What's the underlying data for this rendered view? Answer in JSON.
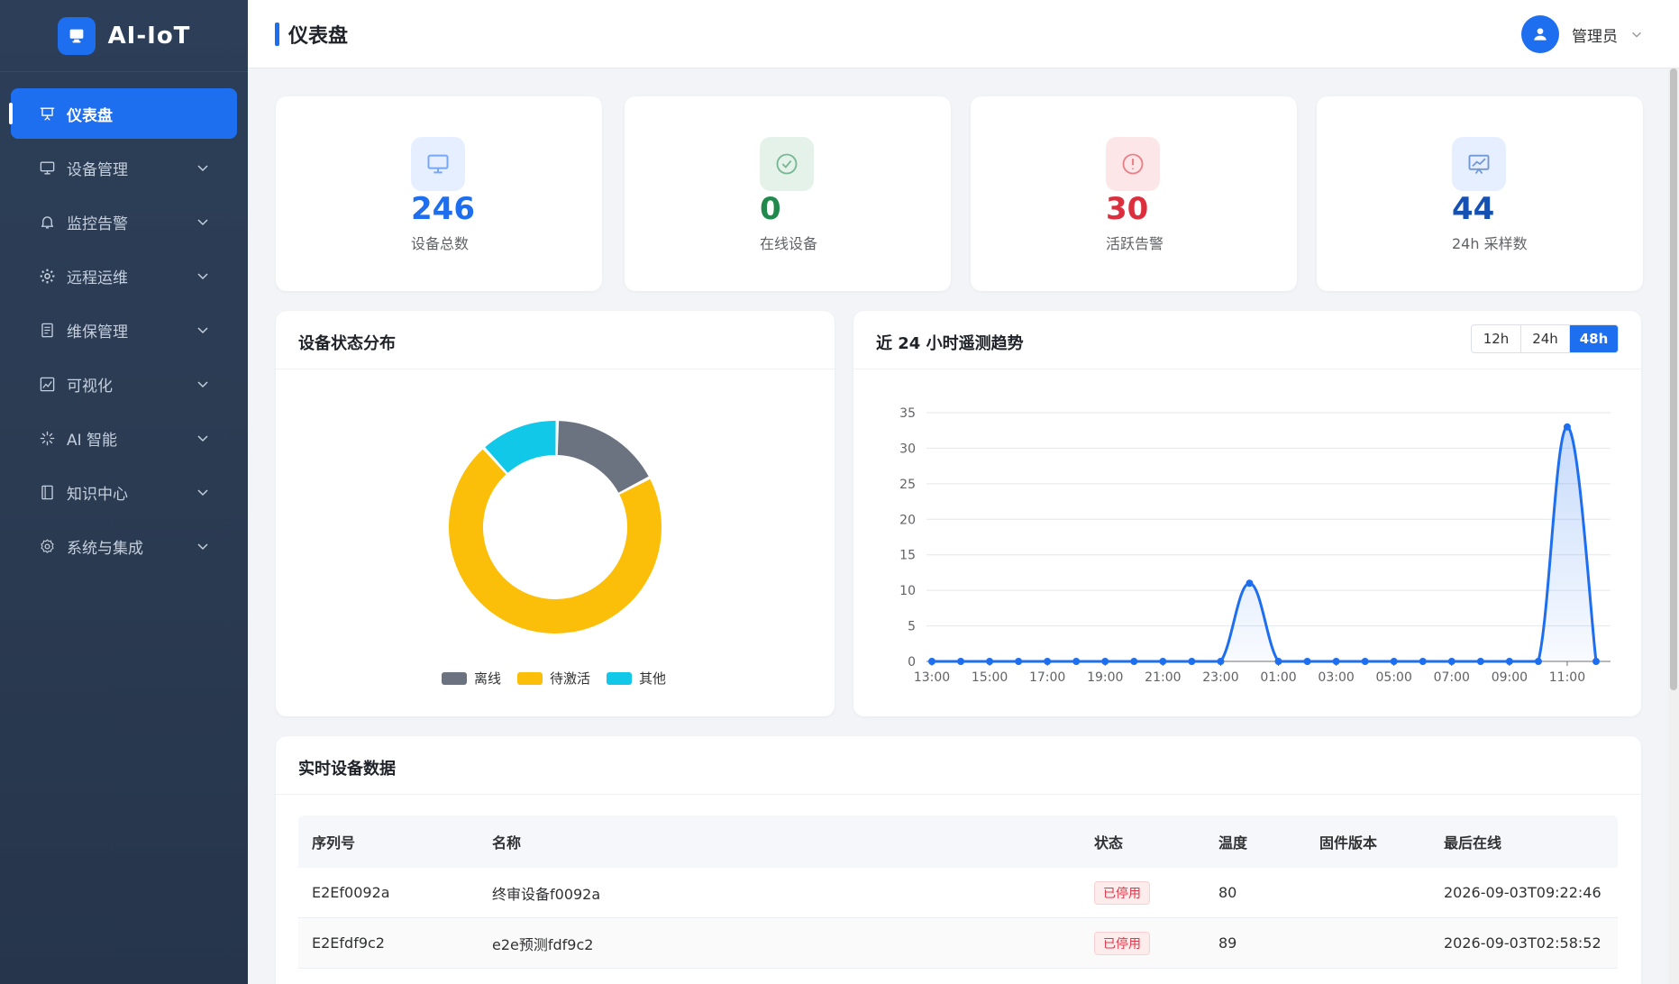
{
  "brand": {
    "name": "AI-IoT"
  },
  "sidebar": {
    "items": [
      {
        "label": "仪表盘",
        "icon": "presentation-icon",
        "active": true
      },
      {
        "label": "设备管理",
        "icon": "monitor-icon"
      },
      {
        "label": "监控告警",
        "icon": "bell-icon"
      },
      {
        "label": "远程运维",
        "icon": "gear-icon"
      },
      {
        "label": "维保管理",
        "icon": "document-icon"
      },
      {
        "label": "可视化",
        "icon": "image-chart-icon"
      },
      {
        "label": "AI 智能",
        "icon": "loading-spark-icon"
      },
      {
        "label": "知识中心",
        "icon": "notebook-icon"
      },
      {
        "label": "系统与集成",
        "icon": "settings-icon"
      }
    ]
  },
  "header": {
    "title": "仪表盘",
    "user_name": "管理员"
  },
  "stats": [
    {
      "value": "246",
      "label": "设备总数",
      "color": "#1e6ef0",
      "icon_bg": "#e6efff",
      "icon": "monitor-icon"
    },
    {
      "value": "0",
      "label": "在线设备",
      "color": "#1f8a4c",
      "icon_bg": "#e4f2ea",
      "icon": "check-circle-icon"
    },
    {
      "value": "30",
      "label": "活跃告警",
      "color": "#dc2f3d",
      "icon_bg": "#fde6e7",
      "icon": "warning-circle-icon"
    },
    {
      "value": "44",
      "label": "24h 采样数",
      "color": "#1550b3",
      "icon_bg": "#e6efff",
      "icon": "trend-board-icon"
    }
  ],
  "status_panel": {
    "title": "设备状态分布"
  },
  "trend_panel": {
    "title": "近 24 小时遥测趋势",
    "ranges": [
      "12h",
      "24h",
      "48h"
    ],
    "active_range": "48h"
  },
  "chart_data": [
    {
      "type": "pie",
      "donut": true,
      "labels": [
        "离线",
        "待激活",
        "其他"
      ],
      "values": [
        17,
        71,
        12
      ],
      "colors": [
        "#6b7280",
        "#fbbf0a",
        "#11c8e8"
      ],
      "legend": "bottom"
    },
    {
      "type": "area",
      "x": [
        "13:00",
        "14:00",
        "15:00",
        "16:00",
        "17:00",
        "18:00",
        "19:00",
        "20:00",
        "21:00",
        "22:00",
        "23:00",
        "00:00",
        "01:00",
        "02:00",
        "03:00",
        "04:00",
        "05:00",
        "06:00",
        "07:00",
        "08:00",
        "09:00",
        "10:00",
        "11:00",
        "12:00"
      ],
      "xticks": [
        "13:00",
        "15:00",
        "17:00",
        "19:00",
        "21:00",
        "23:00",
        "01:00",
        "03:00",
        "05:00",
        "07:00",
        "09:00",
        "11:00"
      ],
      "values": [
        0,
        0,
        0,
        0,
        0,
        0,
        0,
        0,
        0,
        0,
        0,
        11,
        0,
        0,
        0,
        0,
        0,
        0,
        0,
        0,
        0,
        0,
        33,
        0
      ],
      "ylim": [
        0,
        35
      ],
      "yticks": [
        0,
        5,
        10,
        15,
        20,
        25,
        30,
        35
      ],
      "grid": true,
      "color": "#1e6ef0"
    }
  ],
  "table": {
    "title": "实时设备数据",
    "columns": [
      "序列号",
      "名称",
      "状态",
      "温度",
      "固件版本",
      "最后在线"
    ],
    "rows": [
      [
        "E2Ef0092a",
        "终审设备f0092a",
        "已停用",
        "80",
        "",
        "2026-09-03T09:22:46"
      ],
      [
        "E2Efdf9c2",
        "e2e预测fdf9c2",
        "已停用",
        "89",
        "",
        "2026-09-03T02:58:52"
      ]
    ]
  }
}
